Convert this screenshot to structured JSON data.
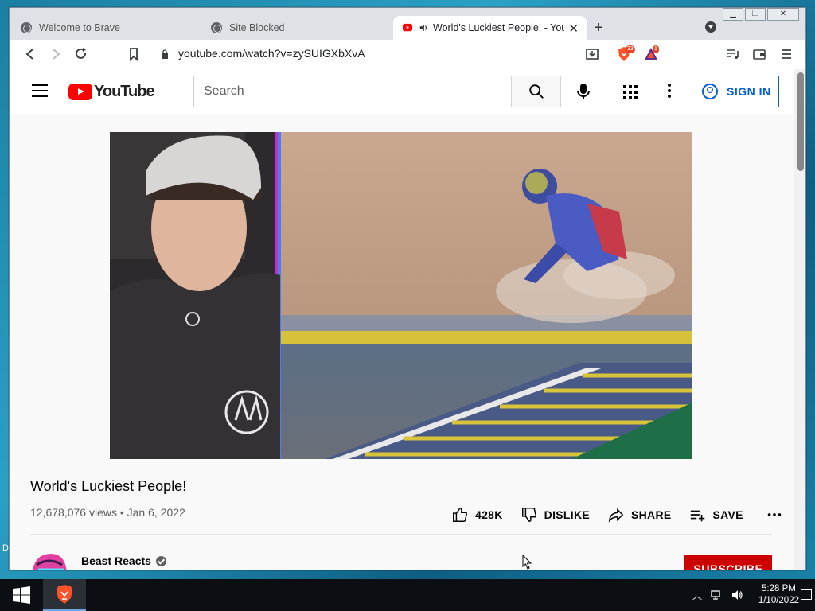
{
  "browser": {
    "tabs": [
      {
        "title": "Welcome to Brave",
        "active": false
      },
      {
        "title": "Site Blocked",
        "active": false
      },
      {
        "title": "World's Luckiest People! - You",
        "active": true
      }
    ],
    "url": "youtube.com/watch?v=zySUIGXbXvA",
    "shields_count": "33",
    "rewards_count": "1"
  },
  "youtube": {
    "logo_text": "YouTube",
    "search_placeholder": "Search",
    "signin_label": "SIGN IN",
    "video": {
      "title": "World's Luckiest People!",
      "meta": "12,678,076 views • Jan 6, 2022",
      "likes": "428K",
      "dislike_label": "DISLIKE",
      "share_label": "SHARE",
      "save_label": "SAVE"
    },
    "channel": {
      "name": "Beast Reacts",
      "subscribe_label": "SUBSCRIBE"
    }
  },
  "taskbar": {
    "time": "5:28 PM",
    "date": "1/10/2022"
  },
  "desktop_fragment": "D"
}
